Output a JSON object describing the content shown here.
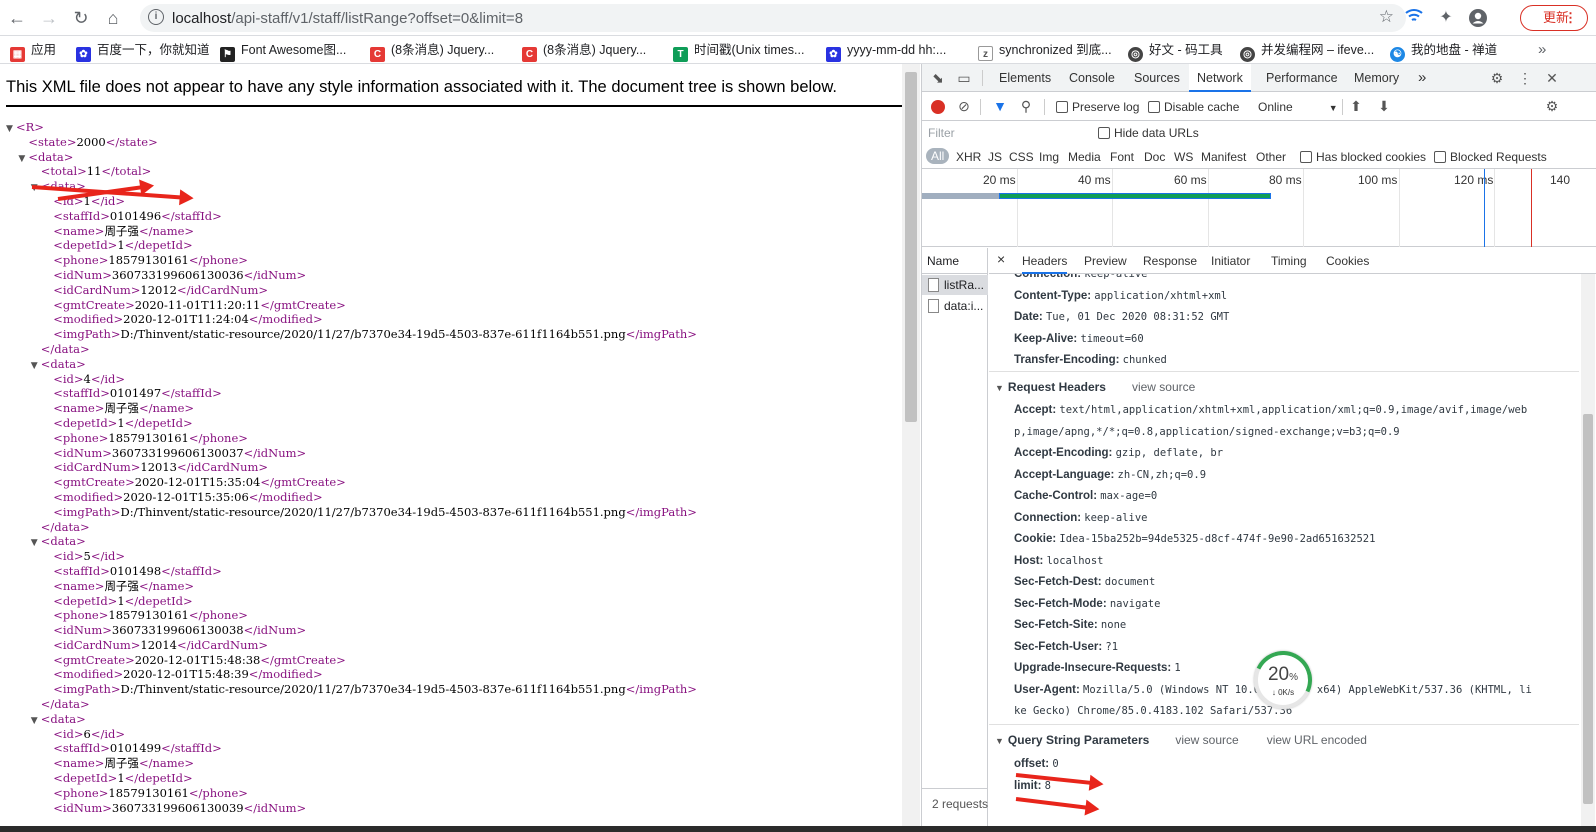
{
  "browser": {
    "url_host": "localhost",
    "url_path": "/api-staff/v1/staff/listRange?offset=0&limit=8",
    "update_label": "更新"
  },
  "bookmarks": [
    {
      "label": "应用",
      "icon": "apps-grid-icon",
      "color": "#e53935"
    },
    {
      "label": "百度一下，你就知道",
      "icon": "baidu-paw-icon",
      "color": "#2932e1"
    },
    {
      "label": "Font Awesome图...",
      "icon": "flag-icon",
      "color": "#222222"
    },
    {
      "label": "(8条消息) Jquery...",
      "icon": "csdn-icon",
      "color": "#e53935"
    },
    {
      "label": "(8条消息) Jquery...",
      "icon": "csdn-icon",
      "color": "#e53935"
    },
    {
      "label": "时间戳(Unix times...",
      "icon": "tool-icon",
      "color": "#0f9d58"
    },
    {
      "label": "yyyy-mm-dd hh:...",
      "icon": "paw-icon",
      "color": "#2932e1"
    },
    {
      "label": "synchronized 到底...",
      "icon": "zhihu-icon",
      "color": "#555555"
    },
    {
      "label": "好文 - 码工具",
      "icon": "globe-icon",
      "color": "#444444"
    },
    {
      "label": "并发编程网 – ifeve...",
      "icon": "globe-icon",
      "color": "#444444"
    },
    {
      "label": "我的地盘 - 禅道",
      "icon": "zentao-icon",
      "color": "#1e88e5"
    }
  ],
  "xml": {
    "notice": "This XML file does not appear to have any style information associated with it. The document tree is shown below.",
    "lines": [
      {
        "t": "▼",
        "i": 0,
        "open": "R",
        "text": "",
        "close": ""
      },
      {
        "t": "",
        "i": 1,
        "open": "state",
        "text": "2000",
        "close": "state"
      },
      {
        "t": "▼",
        "i": 1,
        "open": "data",
        "text": "",
        "close": ""
      },
      {
        "t": "",
        "i": 2,
        "open": "total",
        "text": "11",
        "close": "total"
      },
      {
        "t": "▼",
        "i": 2,
        "open": "data",
        "text": "",
        "close": ""
      },
      {
        "t": "",
        "i": 3,
        "open": "id",
        "text": "1",
        "close": "id"
      },
      {
        "t": "",
        "i": 3,
        "open": "staffId",
        "text": "0101496",
        "close": "staffId"
      },
      {
        "t": "",
        "i": 3,
        "open": "name",
        "text": "周子强",
        "close": "name"
      },
      {
        "t": "",
        "i": 3,
        "open": "depetId",
        "text": "1",
        "close": "depetId"
      },
      {
        "t": "",
        "i": 3,
        "open": "phone",
        "text": "18579130161",
        "close": "phone"
      },
      {
        "t": "",
        "i": 3,
        "open": "idNum",
        "text": "360733199606130036",
        "close": "idNum"
      },
      {
        "t": "",
        "i": 3,
        "open": "idCardNum",
        "text": "12012",
        "close": "idCardNum"
      },
      {
        "t": "",
        "i": 3,
        "open": "gmtCreate",
        "text": "2020-11-01T11:20:11",
        "close": "gmtCreate"
      },
      {
        "t": "",
        "i": 3,
        "open": "modified",
        "text": "2020-12-01T11:24:04",
        "close": "modified"
      },
      {
        "t": "",
        "i": 3,
        "open": "imgPath",
        "text": "D:/Thinvent/static-resource/2020/11/27/b7370e34-19d5-4503-837e-611f1164b551.png",
        "close": "imgPath"
      },
      {
        "t": "",
        "i": 2,
        "open": "",
        "text": "",
        "close": "data"
      },
      {
        "t": "▼",
        "i": 2,
        "open": "data",
        "text": "",
        "close": ""
      },
      {
        "t": "",
        "i": 3,
        "open": "id",
        "text": "4",
        "close": "id"
      },
      {
        "t": "",
        "i": 3,
        "open": "staffId",
        "text": "0101497",
        "close": "staffId"
      },
      {
        "t": "",
        "i": 3,
        "open": "name",
        "text": "周子强",
        "close": "name"
      },
      {
        "t": "",
        "i": 3,
        "open": "depetId",
        "text": "1",
        "close": "depetId"
      },
      {
        "t": "",
        "i": 3,
        "open": "phone",
        "text": "18579130161",
        "close": "phone"
      },
      {
        "t": "",
        "i": 3,
        "open": "idNum",
        "text": "360733199606130037",
        "close": "idNum"
      },
      {
        "t": "",
        "i": 3,
        "open": "idCardNum",
        "text": "12013",
        "close": "idCardNum"
      },
      {
        "t": "",
        "i": 3,
        "open": "gmtCreate",
        "text": "2020-12-01T15:35:04",
        "close": "gmtCreate"
      },
      {
        "t": "",
        "i": 3,
        "open": "modified",
        "text": "2020-12-01T15:35:06",
        "close": "modified"
      },
      {
        "t": "",
        "i": 3,
        "open": "imgPath",
        "text": "D:/Thinvent/static-resource/2020/11/27/b7370e34-19d5-4503-837e-611f1164b551.png",
        "close": "imgPath"
      },
      {
        "t": "",
        "i": 2,
        "open": "",
        "text": "",
        "close": "data"
      },
      {
        "t": "▼",
        "i": 2,
        "open": "data",
        "text": "",
        "close": ""
      },
      {
        "t": "",
        "i": 3,
        "open": "id",
        "text": "5",
        "close": "id"
      },
      {
        "t": "",
        "i": 3,
        "open": "staffId",
        "text": "0101498",
        "close": "staffId"
      },
      {
        "t": "",
        "i": 3,
        "open": "name",
        "text": "周子强",
        "close": "name"
      },
      {
        "t": "",
        "i": 3,
        "open": "depetId",
        "text": "1",
        "close": "depetId"
      },
      {
        "t": "",
        "i": 3,
        "open": "phone",
        "text": "18579130161",
        "close": "phone"
      },
      {
        "t": "",
        "i": 3,
        "open": "idNum",
        "text": "360733199606130038",
        "close": "idNum"
      },
      {
        "t": "",
        "i": 3,
        "open": "idCardNum",
        "text": "12014",
        "close": "idCardNum"
      },
      {
        "t": "",
        "i": 3,
        "open": "gmtCreate",
        "text": "2020-12-01T15:48:38",
        "close": "gmtCreate"
      },
      {
        "t": "",
        "i": 3,
        "open": "modified",
        "text": "2020-12-01T15:48:39",
        "close": "modified"
      },
      {
        "t": "",
        "i": 3,
        "open": "imgPath",
        "text": "D:/Thinvent/static-resource/2020/11/27/b7370e34-19d5-4503-837e-611f1164b551.png",
        "close": "imgPath"
      },
      {
        "t": "",
        "i": 2,
        "open": "",
        "text": "",
        "close": "data"
      },
      {
        "t": "▼",
        "i": 2,
        "open": "data",
        "text": "",
        "close": ""
      },
      {
        "t": "",
        "i": 3,
        "open": "id",
        "text": "6",
        "close": "id"
      },
      {
        "t": "",
        "i": 3,
        "open": "staffId",
        "text": "0101499",
        "close": "staffId"
      },
      {
        "t": "",
        "i": 3,
        "open": "name",
        "text": "周子强",
        "close": "name"
      },
      {
        "t": "",
        "i": 3,
        "open": "depetId",
        "text": "1",
        "close": "depetId"
      },
      {
        "t": "",
        "i": 3,
        "open": "phone",
        "text": "18579130161",
        "close": "phone"
      },
      {
        "t": "",
        "i": 3,
        "open": "idNum",
        "text": "360733199606130039",
        "close": "idNum"
      }
    ]
  },
  "devtools": {
    "tabs": [
      "Elements",
      "Console",
      "Sources",
      "Network",
      "Performance",
      "Memory"
    ],
    "active_tab": "Network",
    "more": "»",
    "toolbar": {
      "preserve_log": "Preserve log",
      "disable_cache": "Disable cache",
      "throttle": "Online"
    },
    "filter": {
      "placeholder": "Filter",
      "hide_data_urls": "Hide data URLs"
    },
    "types": [
      "All",
      "XHR",
      "JS",
      "CSS",
      "Img",
      "Media",
      "Font",
      "Doc",
      "WS",
      "Manifest",
      "Other"
    ],
    "blocked_cookies": "Has blocked cookies",
    "blocked_requests": "Blocked Requests",
    "timeline_labels": [
      "20 ms",
      "40 ms",
      "60 ms",
      "80 ms",
      "100 ms",
      "120 ms",
      "140"
    ],
    "name_header": "Name",
    "requests": [
      "listRa...",
      "data:i..."
    ],
    "request_count": "2 requests",
    "detail_tabs": [
      "Headers",
      "Preview",
      "Response",
      "Initiator",
      "Timing",
      "Cookies"
    ],
    "close_symbol": "×",
    "response_headers": [
      {
        "k": "Connection:",
        "v": "keep-alive"
      },
      {
        "k": "Content-Type:",
        "v": "application/xhtml+xml"
      },
      {
        "k": "Date:",
        "v": "Tue, 01 Dec 2020 08:31:52 GMT"
      },
      {
        "k": "Keep-Alive:",
        "v": "timeout=60"
      },
      {
        "k": "Transfer-Encoding:",
        "v": "chunked"
      }
    ],
    "request_headers_title": "Request Headers",
    "view_source": "view source",
    "request_headers": [
      {
        "k": "Accept:",
        "v": "text/html,application/xhtml+xml,application/xml;q=0.9,image/avif,image/web"
      },
      {
        "k": "",
        "v": "p,image/apng,*/*;q=0.8,application/signed-exchange;v=b3;q=0.9"
      },
      {
        "k": "Accept-Encoding:",
        "v": "gzip, deflate, br"
      },
      {
        "k": "Accept-Language:",
        "v": "zh-CN,zh;q=0.9"
      },
      {
        "k": "Cache-Control:",
        "v": "max-age=0"
      },
      {
        "k": "Connection:",
        "v": "keep-alive"
      },
      {
        "k": "Cookie:",
        "v": "Idea-15ba252b=94de5325-d8cf-474f-9e90-2ad651632521"
      },
      {
        "k": "Host:",
        "v": "localhost"
      },
      {
        "k": "Sec-Fetch-Dest:",
        "v": "document"
      },
      {
        "k": "Sec-Fetch-Mode:",
        "v": "navigate"
      },
      {
        "k": "Sec-Fetch-Site:",
        "v": "none"
      },
      {
        "k": "Sec-Fetch-User:",
        "v": "?1"
      },
      {
        "k": "Upgrade-Insecure-Requests:",
        "v": "1"
      },
      {
        "k": "User-Agent:",
        "v": "Mozilla/5.0 (Windows NT 10.0; Win64; x64) AppleWebKit/537.36 (KHTML, li"
      },
      {
        "k": "",
        "v": "ke Gecko) Chrome/85.0.4183.102 Safari/537.36"
      }
    ],
    "query_title": "Query String Parameters",
    "view_url_encoded": "view URL encoded",
    "query_params": [
      {
        "k": "offset:",
        "v": "0"
      },
      {
        "k": "limit:",
        "v": "8"
      }
    ]
  },
  "speed_widget": {
    "percent": "20",
    "percent_sign": "%",
    "rate": "↓ 0K/s",
    "level": 0.2
  },
  "colors": {
    "tag": "#881280",
    "accent": "#1a73e8",
    "annotation": "#e8251b",
    "record": "#d93025"
  }
}
